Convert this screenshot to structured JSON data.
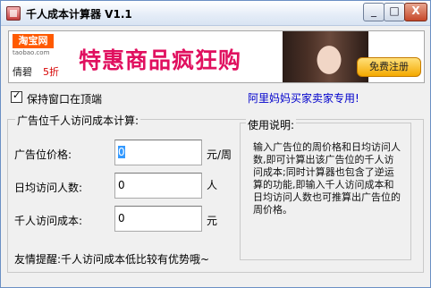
{
  "window": {
    "title": "千人成本计算器 V1.1"
  },
  "titlebar_controls": {
    "minimize": "_",
    "maximize": "□",
    "close": "X"
  },
  "banner": {
    "logo": "淘宝网",
    "domain": "taobao.com",
    "brand": "倩碧",
    "discount": "5折",
    "promo": "特惠商品疯狂购",
    "register_button": "免费注册"
  },
  "options": {
    "stay_on_top_label": "保持窗口在顶端",
    "stay_on_top_checked": true
  },
  "link": {
    "text": "阿里妈妈买家卖家专用!"
  },
  "calculator": {
    "group_title": "广告位千人访问成本计算:",
    "fields": [
      {
        "label": "广告位价格:",
        "value": "0",
        "unit": "元/周"
      },
      {
        "label": "日均访问人数:",
        "value": "0",
        "unit": "人"
      },
      {
        "label": "千人访问成本:",
        "value": "0",
        "unit": "元"
      }
    ],
    "tip": "友情提醒:千人访问成本低比较有优势哦~"
  },
  "help": {
    "title": "使用说明:",
    "text": "输入广告位的周价格和日均访问人数,即可计算出该广告位的千人访问成本;同时计算器也包含了逆运算的功能,即输入千人访问成本和日均访问人数也可推算出广告位的周价格。"
  }
}
